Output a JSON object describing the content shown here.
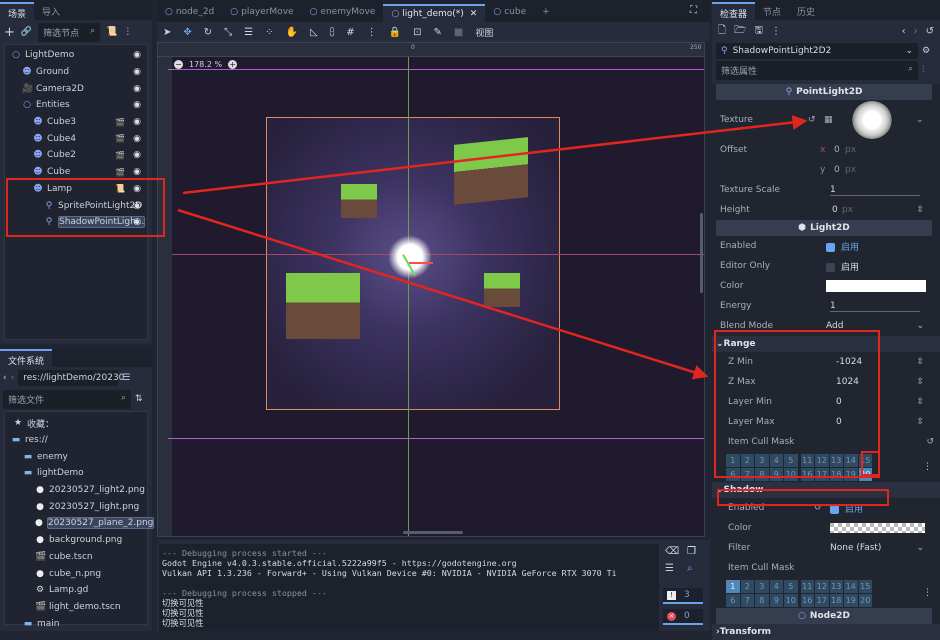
{
  "scene_dock": {
    "tabs": [
      "场景",
      "导入"
    ],
    "filter_placeholder": "筛选节点",
    "nodes": [
      {
        "name": "LightDemo",
        "icon": "node2d-icon",
        "depth": 0
      },
      {
        "name": "Ground",
        "icon": "sprite-icon",
        "depth": 1
      },
      {
        "name": "Camera2D",
        "icon": "camera-icon",
        "depth": 1
      },
      {
        "name": "Entities",
        "icon": "node2d-icon",
        "depth": 1
      },
      {
        "name": "Cube3",
        "icon": "sprite-icon",
        "depth": 2,
        "scene": true
      },
      {
        "name": "Cube4",
        "icon": "sprite-icon",
        "depth": 2,
        "scene": true
      },
      {
        "name": "Cube2",
        "icon": "sprite-icon",
        "depth": 2,
        "scene": true
      },
      {
        "name": "Cube",
        "icon": "sprite-icon",
        "depth": 2,
        "scene": true
      },
      {
        "name": "Lamp",
        "icon": "sprite-icon",
        "depth": 2,
        "script": true
      },
      {
        "name": "SpritePointLight2D",
        "icon": "light-icon",
        "depth": 3
      },
      {
        "name": "ShadowPointLigh...",
        "icon": "light-icon",
        "depth": 3,
        "selected": true
      }
    ]
  },
  "filesystem": {
    "tab": "文件系统",
    "path": "res://lightDemo/20230",
    "filter_placeholder": "筛选文件",
    "favorites": "收藏：",
    "items": [
      {
        "name": "res://",
        "type": "folder",
        "depth": 0
      },
      {
        "name": "enemy",
        "type": "folder",
        "depth": 1
      },
      {
        "name": "lightDemo",
        "type": "folder",
        "depth": 1
      },
      {
        "name": "20230527_light2.png",
        "type": "image",
        "depth": 2
      },
      {
        "name": "20230527_light.png",
        "type": "image",
        "depth": 2
      },
      {
        "name": "20230527_plane_2.png",
        "type": "image",
        "depth": 2,
        "selected": true
      },
      {
        "name": "background.png",
        "type": "image",
        "depth": 2
      },
      {
        "name": "cube.tscn",
        "type": "scene",
        "depth": 2
      },
      {
        "name": "cube_n.png",
        "type": "image",
        "depth": 2
      },
      {
        "name": "Lamp.gd",
        "type": "script",
        "depth": 2
      },
      {
        "name": "light_demo.tscn",
        "type": "scene",
        "depth": 2
      },
      {
        "name": "main",
        "type": "folder",
        "depth": 1
      }
    ]
  },
  "editor": {
    "tabs": [
      "node_2d",
      "playerMove",
      "enemyMove",
      "light_demo(*)",
      "cube"
    ],
    "active_tab": 3,
    "view_menu": "视图",
    "zoom": "178.2 %",
    "ruler": [
      "0",
      "250"
    ]
  },
  "output": {
    "lines": [
      "--- Debugging process started ---",
      "Godot Engine v4.0.3.stable.official.5222a99f5 - https://godotengine.org",
      "Vulkan API 1.3.236 - Forward+ - Using Vulkan Device #0: NVIDIA - NVIDIA GeForce RTX 3070 Ti",
      "",
      "--- Debugging process stopped ---",
      "切换可见性",
      "切换可见性",
      "切换可见性"
    ],
    "warnings": "3",
    "errors": "0"
  },
  "inspector": {
    "tabs": [
      "检查器",
      "节点",
      "历史"
    ],
    "node": "ShadowPointLight2D2",
    "filter_placeholder": "筛选属性",
    "pointlight": {
      "title": "PointLight2D",
      "texture": "Texture",
      "offset": "Offset",
      "x": "x",
      "y": "y",
      "zero": "0",
      "px": "px",
      "texture_scale": "Texture Scale",
      "texture_scale_val": "1",
      "height": "Height",
      "height_val": "0"
    },
    "light2d": {
      "title": "Light2D",
      "enabled": "Enabled",
      "enable_text": "启用",
      "editor_only": "Editor Only",
      "color": "Color",
      "energy": "Energy",
      "energy_val": "1",
      "blend_mode": "Blend Mode",
      "blend_val": "Add"
    },
    "range": {
      "title": "Range",
      "z_min": "Z Min",
      "z_min_val": "-1024",
      "z_max": "Z Max",
      "z_max_val": "1024",
      "layer_min": "Layer Min",
      "layer_min_val": "0",
      "layer_max": "Layer Max",
      "layer_max_val": "0",
      "cull_mask": "Item Cull Mask",
      "active_layer": 20
    },
    "shadow": {
      "title": "Shadow",
      "enabled": "Enabled",
      "enable_text": "启用",
      "color": "Color",
      "filter": "Filter",
      "filter_val": "None (Fast)",
      "cull_mask": "Item Cull Mask",
      "active_layer": 1
    },
    "node2d": {
      "title": "Node2D",
      "transform": "Transform"
    }
  },
  "colors": {
    "accent": "#6aa4ef",
    "annotation": "#e0261f",
    "scene_bounds": "#e08a5a"
  }
}
